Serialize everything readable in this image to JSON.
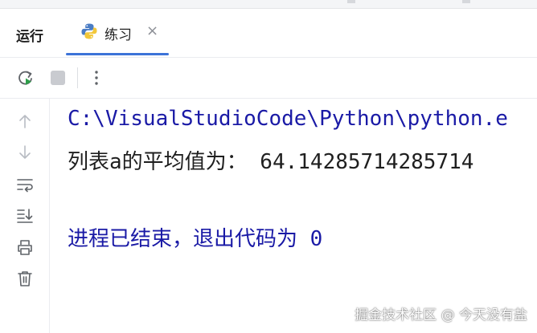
{
  "run_panel": {
    "title": "运行",
    "tab": {
      "label": "练习",
      "close": "×",
      "icon": "python-icon"
    }
  },
  "toolbar": {
    "icons": [
      "rerun-icon",
      "stop-icon",
      "more-options-icon"
    ]
  },
  "gutter": {
    "icons": [
      "scroll-up-icon",
      "scroll-down-icon",
      "soft-wrap-icon",
      "scroll-to-end-icon",
      "print-icon",
      "clear-all-icon"
    ]
  },
  "console": {
    "path_line": "C:\\VisualStudioCode\\Python\\python.e",
    "output_line": "列表a的平均值为： 64.14285714285714",
    "exit_line": "进程已结束，退出代码为 0"
  },
  "watermark": "掘金技术社区 @ 今天没有盐",
  "colors": {
    "accent": "#3c73d8",
    "console_path": "#1a1aa6",
    "console_text": "#1f1f1f",
    "rerun_green": "#2e9e4a"
  }
}
